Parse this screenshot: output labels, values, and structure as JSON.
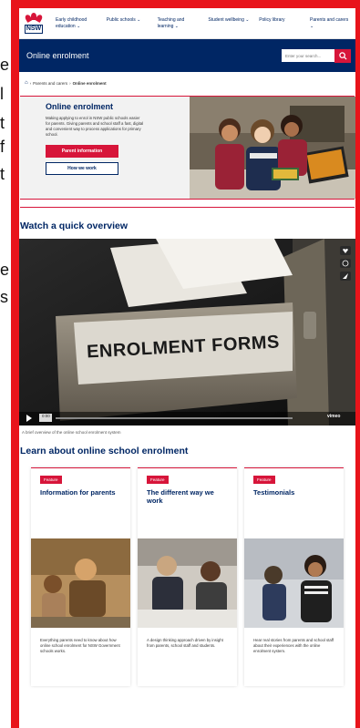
{
  "left_fragments": [
    "e",
    "l",
    "t",
    "f",
    "t",
    "e",
    "s"
  ],
  "topnav": {
    "logo_text": "NSW",
    "items": [
      {
        "label": "Early childhood education"
      },
      {
        "label": "Public schools"
      },
      {
        "label": "Teaching and learning"
      },
      {
        "label": "Student wellbeing"
      },
      {
        "label": "Policy library"
      },
      {
        "label": "Parents and carers"
      }
    ]
  },
  "banner": {
    "title": "Online enrolment",
    "search_placeholder": "Enter your search..."
  },
  "breadcrumb": {
    "parent": "Parents and carers",
    "current": "Online enrolment"
  },
  "hero": {
    "title": "Online enrolment",
    "description": "Making applying to enrol in NSW public schools easier for parents. Giving parents and school staff a fast, digital and convenient way to process applications for primary school.",
    "primary_button": "Parent information",
    "secondary_button": "How we work"
  },
  "overview": {
    "title": "Watch a quick overview",
    "video_sign": "ENROLMENT FORMS",
    "time_label": "0:00",
    "vimeo_label": "vimeo",
    "caption": "A brief overview of the online school enrolment system"
  },
  "learn": {
    "title": "Learn about online school enrolment",
    "cards": [
      {
        "badge": "Feature",
        "title": "Information for parents",
        "description": "Everything parents need to know about how online school enrolment for NSW Government schools works."
      },
      {
        "badge": "Feature",
        "title": "The different way we work",
        "description": "A design thinking approach driven by insight from parents, school staff and students."
      },
      {
        "badge": "Feature",
        "title": "Testimonials",
        "description": "Hear real stories from parents and school staff about their experiences with the online enrolment system."
      }
    ]
  },
  "colors": {
    "navy": "#002664",
    "red": "#d7153a",
    "frame_red": "#e8141b"
  }
}
